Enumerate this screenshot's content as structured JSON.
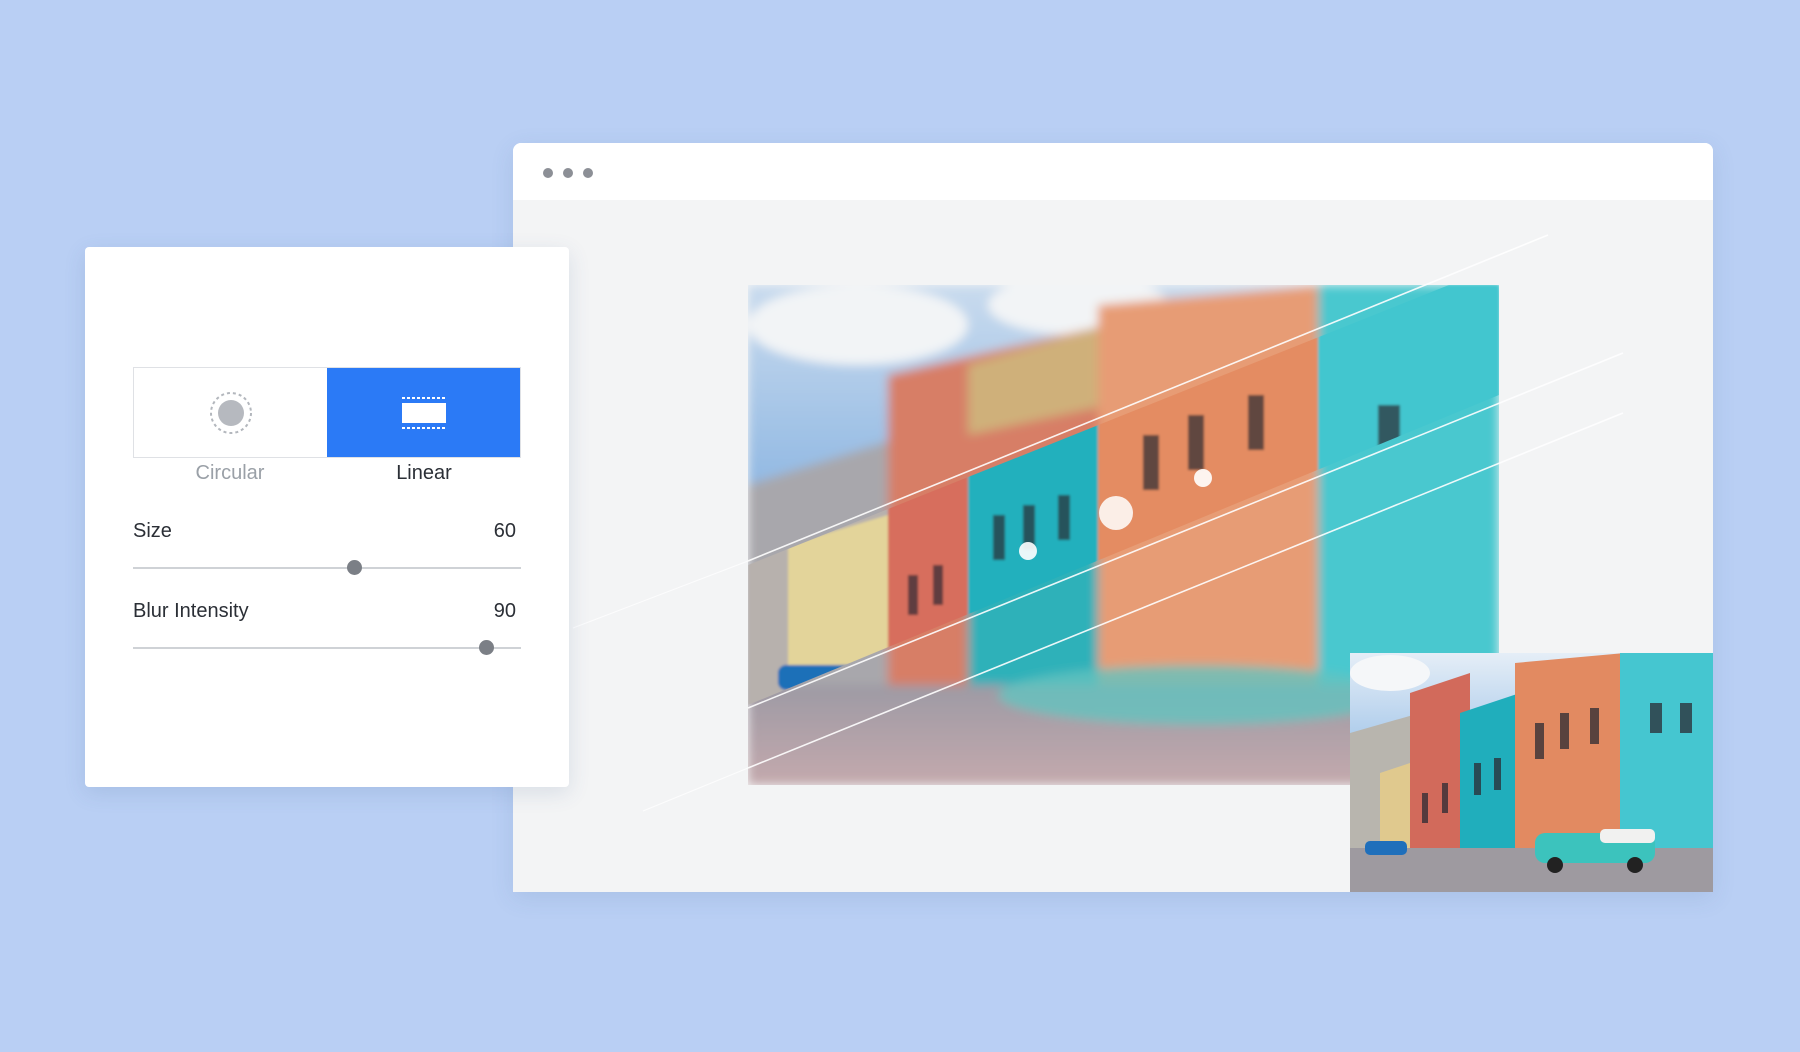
{
  "window": {
    "controls": [
      "window-dot",
      "window-dot",
      "window-dot"
    ]
  },
  "blur_panel": {
    "modes": [
      {
        "label": "Circular",
        "icon": "circular-icon",
        "selected": false
      },
      {
        "label": "Linear",
        "icon": "linear-icon",
        "selected": true
      }
    ],
    "size": {
      "label": "Size",
      "value": "60",
      "fraction": 0.57
    },
    "blur_intensity": {
      "label": "Blur Intensity",
      "value": "90",
      "fraction": 0.91
    }
  },
  "colors": {
    "background": "#b9cff4",
    "accent": "#2b7af6",
    "slider_thumb": "#7b7f86"
  }
}
